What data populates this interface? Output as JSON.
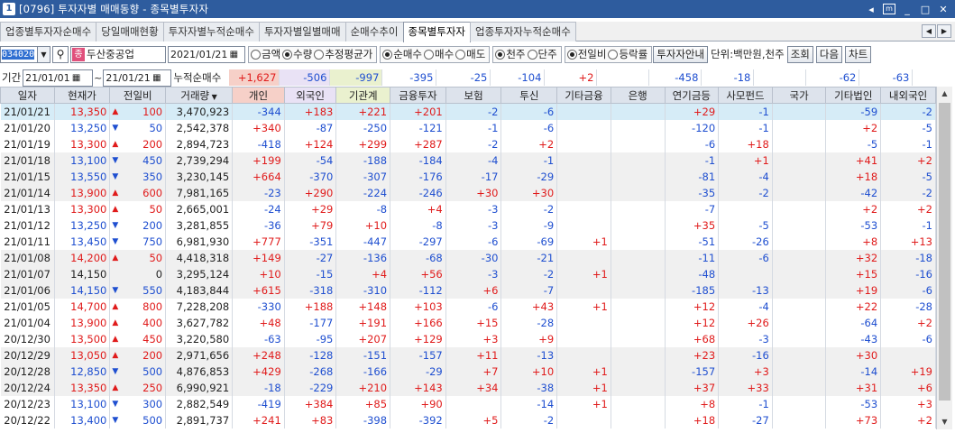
{
  "window": {
    "number": "1",
    "title": "[0796] 투자자별 매매동향 - 종목별투자자"
  },
  "tabs": [
    {
      "label": "업종별투자자순매수",
      "active": false
    },
    {
      "label": "당일매매현황",
      "active": false
    },
    {
      "label": "투자자별누적순매수",
      "active": false
    },
    {
      "label": "투자자별일별매매",
      "active": false
    },
    {
      "label": "순매수추이",
      "active": false
    },
    {
      "label": "종목별투자자",
      "active": true
    },
    {
      "label": "업종투자자누적순매수",
      "active": false
    }
  ],
  "toolbar": {
    "code": "034020",
    "stock_name": "두산중공업",
    "stock_badge": "종",
    "date": "2021/01/21",
    "amt_qty": [
      {
        "label": "금액",
        "on": false
      },
      {
        "label": "수량",
        "on": true
      },
      {
        "label": "추정평균가",
        "on": false
      }
    ],
    "buy_sell": [
      {
        "label": "순매수",
        "on": true
      },
      {
        "label": "매수",
        "on": false
      },
      {
        "label": "매도",
        "on": false
      }
    ],
    "unit_opt": [
      {
        "label": "천주",
        "on": true
      },
      {
        "label": "단주",
        "on": false
      }
    ],
    "cmp_opt": [
      {
        "label": "전일비",
        "on": true
      },
      {
        "label": "등락률",
        "on": false
      }
    ],
    "guide_btn": "투자자안내",
    "unit_text": "단위:백만원,천주",
    "query_btn": "조회",
    "next_btn": "다음",
    "chart_btn": "차트"
  },
  "period": {
    "label": "기간",
    "from": "21/01/01",
    "to": "21/01/21",
    "sum_label": "누적순매수"
  },
  "summary": [
    "+1,627",
    "-506",
    "-997",
    "-395",
    "-25",
    "-104",
    "+2",
    "",
    "-458",
    "-18",
    "",
    "-62",
    "-63"
  ],
  "columns": [
    "일자",
    "현재가",
    "전일비",
    "거래량",
    "개인",
    "외국인",
    "기관계",
    "금융투자",
    "보험",
    "투신",
    "기타금융",
    "은행",
    "연기금등",
    "사모펀드",
    "국가",
    "기타법인",
    "내외국인"
  ],
  "rows": [
    {
      "date": "21/01/21",
      "price": "13,350",
      "dir": "up",
      "chg": "100",
      "vol": "3,470,923",
      "v": [
        "-344",
        "+183",
        "+221",
        "+201",
        "-2",
        "-6",
        "",
        "",
        "+29",
        "-1",
        "",
        "-59",
        "-2"
      ]
    },
    {
      "date": "21/01/20",
      "price": "13,250",
      "dir": "dn",
      "chg": "50",
      "vol": "2,542,378",
      "v": [
        "+340",
        "-87",
        "-250",
        "-121",
        "-1",
        "-6",
        "",
        "",
        "-120",
        "-1",
        "",
        "+2",
        "-5"
      ]
    },
    {
      "date": "21/01/19",
      "price": "13,300",
      "dir": "up",
      "chg": "200",
      "vol": "2,894,723",
      "v": [
        "-418",
        "+124",
        "+299",
        "+287",
        "-2",
        "+2",
        "",
        "",
        "-6",
        "+18",
        "",
        "-5",
        "-1"
      ]
    },
    {
      "date": "21/01/18",
      "price": "13,100",
      "dir": "dn",
      "chg": "450",
      "vol": "2,739,294",
      "v": [
        "+199",
        "-54",
        "-188",
        "-184",
        "-4",
        "-1",
        "",
        "",
        "-1",
        "+1",
        "",
        "+41",
        "+2"
      ]
    },
    {
      "date": "21/01/15",
      "price": "13,550",
      "dir": "dn",
      "chg": "350",
      "vol": "3,230,145",
      "v": [
        "+664",
        "-370",
        "-307",
        "-176",
        "-17",
        "-29",
        "",
        "",
        "-81",
        "-4",
        "",
        "+18",
        "-5"
      ]
    },
    {
      "date": "21/01/14",
      "price": "13,900",
      "dir": "up",
      "chg": "600",
      "vol": "7,981,165",
      "v": [
        "-23",
        "+290",
        "-224",
        "-246",
        "+30",
        "+30",
        "",
        "",
        "-35",
        "-2",
        "",
        "-42",
        "-2"
      ]
    },
    {
      "date": "21/01/13",
      "price": "13,300",
      "dir": "up",
      "chg": "50",
      "vol": "2,665,001",
      "v": [
        "-24",
        "+29",
        "-8",
        "+4",
        "-3",
        "-2",
        "",
        "",
        "-7",
        "",
        "",
        "+2",
        "+2"
      ]
    },
    {
      "date": "21/01/12",
      "price": "13,250",
      "dir": "dn",
      "chg": "200",
      "vol": "3,281,855",
      "v": [
        "-36",
        "+79",
        "+10",
        "-8",
        "-3",
        "-9",
        "",
        "",
        "+35",
        "-5",
        "",
        "-53",
        "-1"
      ]
    },
    {
      "date": "21/01/11",
      "price": "13,450",
      "dir": "dn",
      "chg": "750",
      "vol": "6,981,930",
      "v": [
        "+777",
        "-351",
        "-447",
        "-297",
        "-6",
        "-69",
        "+1",
        "",
        "-51",
        "-26",
        "",
        "+8",
        "+13"
      ]
    },
    {
      "date": "21/01/08",
      "price": "14,200",
      "dir": "up",
      "chg": "50",
      "vol": "4,418,318",
      "v": [
        "+149",
        "-27",
        "-136",
        "-68",
        "-30",
        "-21",
        "",
        "",
        "-11",
        "-6",
        "",
        "+32",
        "-18"
      ]
    },
    {
      "date": "21/01/07",
      "price": "14,150",
      "dir": "none",
      "chg": "0",
      "vol": "3,295,124",
      "v": [
        "+10",
        "-15",
        "+4",
        "+56",
        "-3",
        "-2",
        "+1",
        "",
        "-48",
        "",
        "",
        "+15",
        "-16"
      ]
    },
    {
      "date": "21/01/06",
      "price": "14,150",
      "dir": "dn",
      "chg": "550",
      "vol": "4,183,844",
      "v": [
        "+615",
        "-318",
        "-310",
        "-112",
        "+6",
        "-7",
        "",
        "",
        "-185",
        "-13",
        "",
        "+19",
        "-6"
      ]
    },
    {
      "date": "21/01/05",
      "price": "14,700",
      "dir": "up",
      "chg": "800",
      "vol": "7,228,208",
      "v": [
        "-330",
        "+188",
        "+148",
        "+103",
        "-6",
        "+43",
        "+1",
        "",
        "+12",
        "-4",
        "",
        "+22",
        "-28"
      ]
    },
    {
      "date": "21/01/04",
      "price": "13,900",
      "dir": "up",
      "chg": "400",
      "vol": "3,627,782",
      "v": [
        "+48",
        "-177",
        "+191",
        "+166",
        "+15",
        "-28",
        "",
        "",
        "+12",
        "+26",
        "",
        "-64",
        "+2"
      ]
    },
    {
      "date": "20/12/30",
      "price": "13,500",
      "dir": "up",
      "chg": "450",
      "vol": "3,220,580",
      "v": [
        "-63",
        "-95",
        "+207",
        "+129",
        "+3",
        "+9",
        "",
        "",
        "+68",
        "-3",
        "",
        "-43",
        "-6"
      ]
    },
    {
      "date": "20/12/29",
      "price": "13,050",
      "dir": "up",
      "chg": "200",
      "vol": "2,971,656",
      "v": [
        "+248",
        "-128",
        "-151",
        "-157",
        "+11",
        "-13",
        "",
        "",
        "+23",
        "-16",
        "",
        "+30",
        ""
      ]
    },
    {
      "date": "20/12/28",
      "price": "12,850",
      "dir": "dn",
      "chg": "500",
      "vol": "4,876,853",
      "v": [
        "+429",
        "-268",
        "-166",
        "-29",
        "+7",
        "+10",
        "+1",
        "",
        "-157",
        "+3",
        "",
        "-14",
        "+19"
      ]
    },
    {
      "date": "20/12/24",
      "price": "13,350",
      "dir": "up",
      "chg": "250",
      "vol": "6,990,921",
      "v": [
        "-18",
        "-229",
        "+210",
        "+143",
        "+34",
        "-38",
        "+1",
        "",
        "+37",
        "+33",
        "",
        "+31",
        "+6"
      ]
    },
    {
      "date": "20/12/23",
      "price": "13,100",
      "dir": "dn",
      "chg": "300",
      "vol": "2,882,549",
      "v": [
        "-419",
        "+384",
        "+85",
        "+90",
        "",
        "-14",
        "+1",
        "",
        "+8",
        "-1",
        "",
        "-53",
        "+3"
      ]
    },
    {
      "date": "20/12/22",
      "price": "13,400",
      "dir": "dn",
      "chg": "500",
      "vol": "2,891,737",
      "v": [
        "+241",
        "+83",
        "-398",
        "-392",
        "+5",
        "-2",
        "",
        "",
        "+18",
        "-27",
        "",
        "+73",
        "+2"
      ]
    }
  ],
  "colors": {
    "up": "#e01b1b",
    "down": "#1f4fd0",
    "selected_row": "#d6ecf7",
    "sum_individual": "#f6d0c8",
    "sum_foreign": "#e9e2f5",
    "sum_inst": "#eaf1cf"
  }
}
